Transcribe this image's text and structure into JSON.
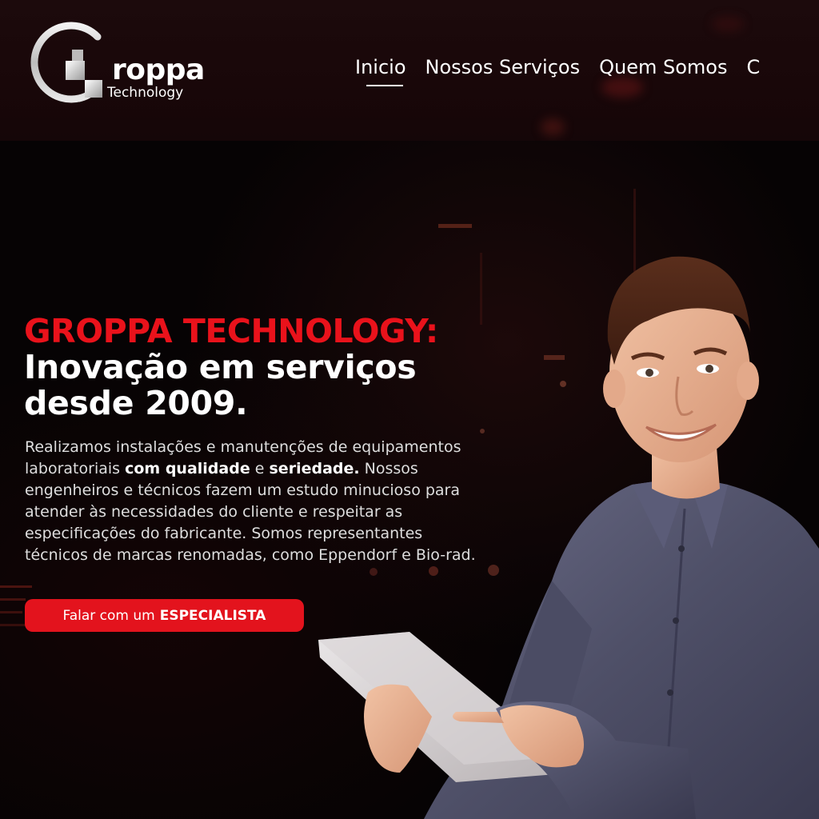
{
  "brand": {
    "logo_letter": "G",
    "name": "roppa",
    "tagline": "Technology"
  },
  "nav": {
    "items": [
      {
        "label": "Inicio"
      },
      {
        "label": "Nossos Serviços"
      },
      {
        "label": "Quem Somos"
      },
      {
        "label": "C"
      }
    ],
    "active_index": 0
  },
  "hero": {
    "title_red": "GROPPA TECHNOLOGY:",
    "title_line_1": "Inovação em serviços",
    "title_line_2": "desde 2009.",
    "body": {
      "p1": "Realizamos instalações e manutenções de equipamentos laboratoriais ",
      "b1": "com qualidade",
      "p2": " e ",
      "b2": "seriedade.",
      "p3": " Nossos engenheiros e técnicos fazem um estudo minucioso para atender às necessidades do cliente e respeitar as especificações do fabricante. Somos representantes técnicos de marcas renomadas, como Eppendorf e Bio-rad."
    },
    "cta": {
      "prefix": "Falar com um",
      "emphasis": "ESPECIALISTA"
    }
  },
  "colors": {
    "accent_red": "#e3131d",
    "title_red": "#e9121b",
    "header_bg": "#1c0a0c",
    "hero_bg": "#060304"
  }
}
